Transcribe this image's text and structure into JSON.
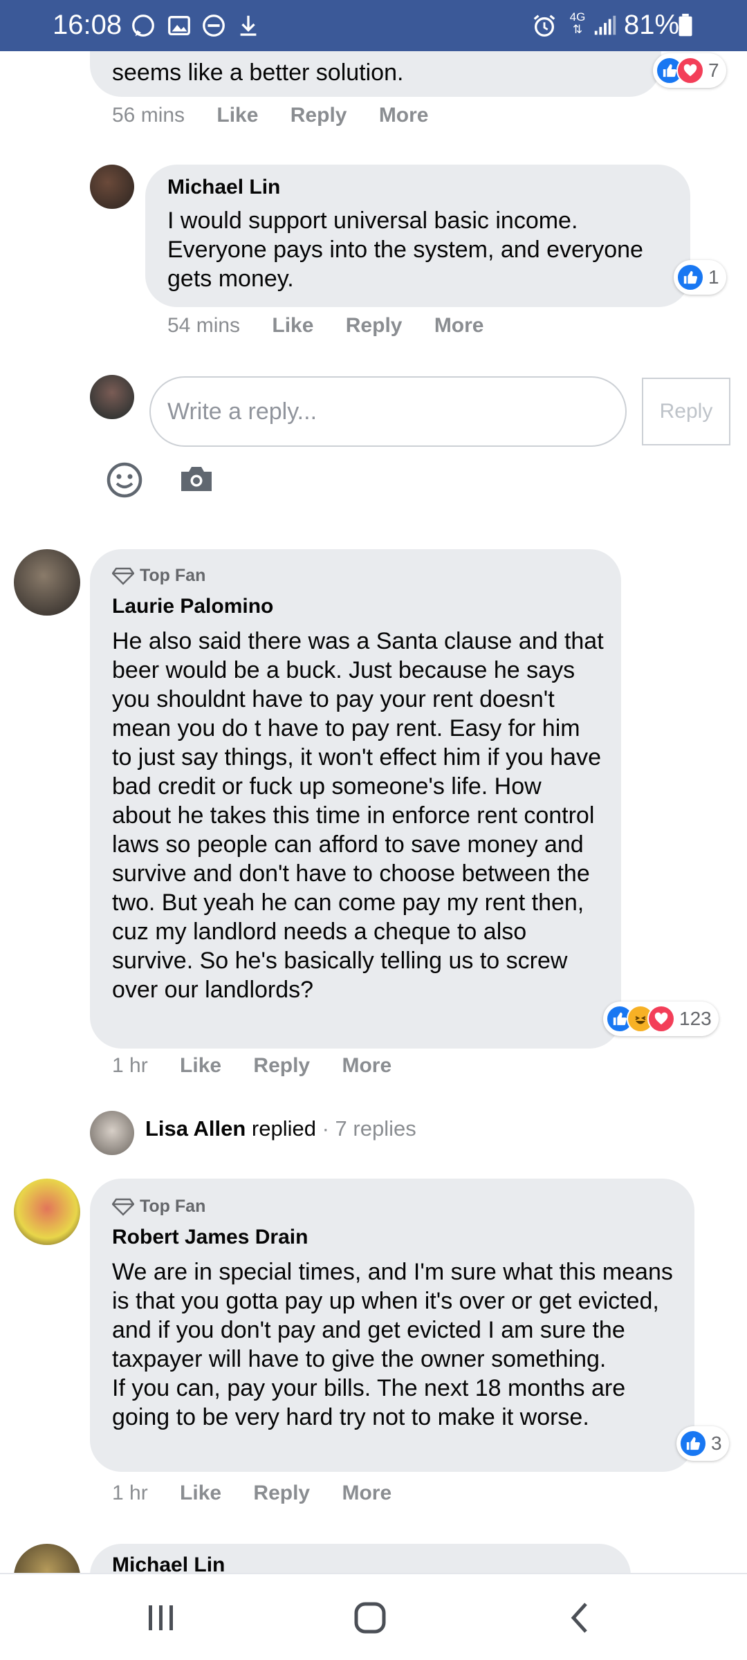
{
  "status_bar": {
    "time": "16:08",
    "network": "4G",
    "battery_percent": "81%",
    "icons": [
      "whatsapp-icon",
      "gallery-icon",
      "do-not-disturb-icon",
      "download-icon",
      "alarm-icon",
      "signal-icon",
      "battery-icon"
    ]
  },
  "thread": {
    "partial_comment": {
      "text": "seems like a better solution.",
      "reaction_count": "7",
      "time": "56 mins"
    },
    "reply_michael": {
      "author": "Michael Lin",
      "text": "I would support universal basic income. Everyone pays into the system, and everyone gets money.",
      "reaction_count": "1",
      "time": "54 mins"
    },
    "reply_box": {
      "placeholder": "Write a reply...",
      "button_label": "Reply"
    },
    "actions": {
      "like": "Like",
      "reply": "Reply",
      "more": "More"
    }
  },
  "comments": [
    {
      "badge": "Top Fan",
      "author": "Laurie Palomino",
      "text": "He also said there was a Santa clause and that beer would be a buck. Just because he says you shouldnt have to pay your rent doesn't mean you do t have to pay rent. Easy for him to just say things, it won't effect him if you have bad credit or fuck up someone's life. How about he takes this time in enforce rent control laws so people can afford to save money and survive and don't have to choose between the two. But yeah he can come pay my rent then, cuz my landlord needs a cheque to also survive. So he's basically telling us to screw over our landlords?",
      "reaction_count": "123",
      "time": "1 hr",
      "replied": {
        "name": "Lisa Allen",
        "verb": "replied",
        "count": "7 replies"
      }
    },
    {
      "badge": "Top Fan",
      "author": "Robert James Drain",
      "text": "We are in special times, and I'm sure what this means is that you gotta pay up when it's over or get evicted, and if you don't pay and get evicted I am sure the taxpayer will have to give the owner something.\nIf you can, pay your bills. The next 18 months are going to be very hard try not to make it worse.",
      "reaction_count": "3",
      "time": "1 hr"
    },
    {
      "author": "Michael Lin"
    }
  ],
  "colors": {
    "status_bar": "#3b5998",
    "bubble": "#e9ebee",
    "like_blue": "#1877f2",
    "love_red": "#f33e58",
    "haha_yellow": "#f7b125",
    "meta_gray": "#8a8d91"
  }
}
